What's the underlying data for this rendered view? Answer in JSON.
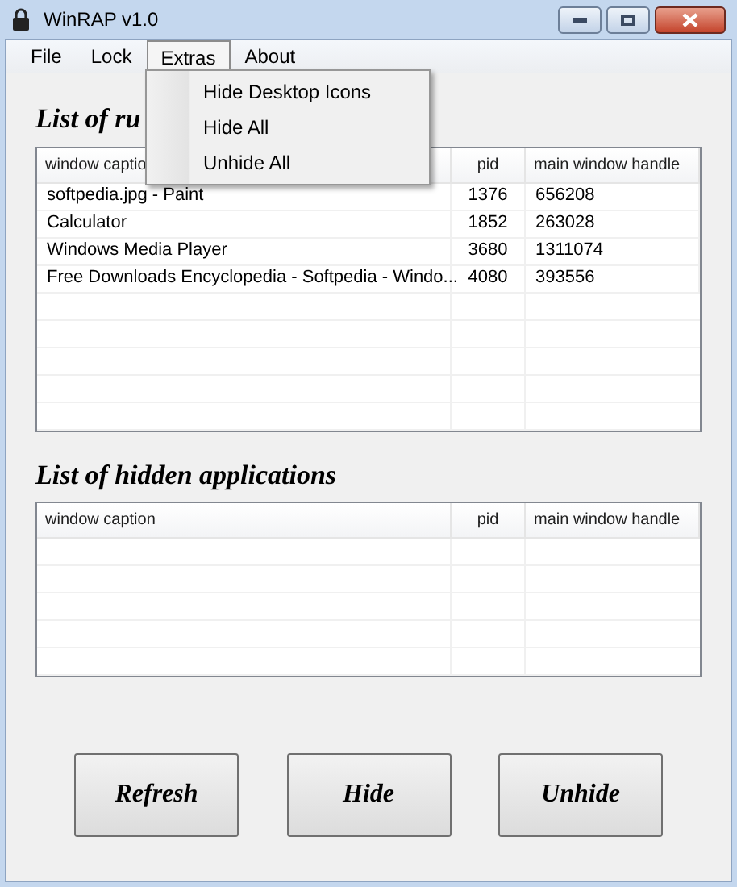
{
  "window": {
    "title": "WinRAP v1.0"
  },
  "menu": [
    {
      "label": "File",
      "selected": false
    },
    {
      "label": "Lock",
      "selected": false
    },
    {
      "label": "Extras",
      "selected": true
    },
    {
      "label": "About",
      "selected": false
    }
  ],
  "dropdown": [
    "Hide Desktop Icons",
    "Hide All",
    "Unhide All"
  ],
  "running": {
    "title": "List of ru",
    "columns": [
      "window captio",
      "pid",
      "main window handle"
    ],
    "rows": [
      [
        "softpedia.jpg - Paint",
        "1376",
        "656208"
      ],
      [
        "Calculator",
        "1852",
        "263028"
      ],
      [
        "Windows Media Player",
        "3680",
        "1311074"
      ],
      [
        "Free Downloads Encyclopedia - Softpedia - Windo...",
        "4080",
        "393556"
      ]
    ]
  },
  "hidden": {
    "title": "List of hidden applications",
    "columns": [
      "window caption",
      "pid",
      "main window handle"
    ]
  },
  "buttons": [
    "Refresh",
    "Hide",
    "Unhide"
  ]
}
